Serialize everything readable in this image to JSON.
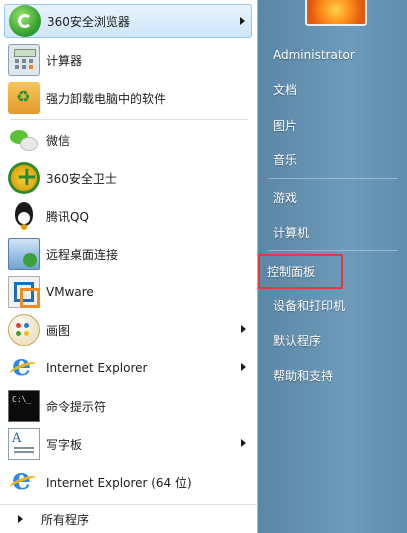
{
  "start_menu": {
    "programs": [
      {
        "label": "360安全浏览器",
        "icon": "browser-360-icon",
        "has_submenu": true
      },
      {
        "label": "计算器",
        "icon": "calculator-icon",
        "has_submenu": false
      },
      {
        "label": "强力卸载电脑中的软件",
        "icon": "uninstall-icon",
        "has_submenu": false
      },
      {
        "label": "微信",
        "icon": "wechat-icon",
        "has_submenu": false
      },
      {
        "label": "360安全卫士",
        "icon": "security-guard-360-icon",
        "has_submenu": false
      },
      {
        "label": "腾讯QQ",
        "icon": "qq-icon",
        "has_submenu": false
      },
      {
        "label": "远程桌面连接",
        "icon": "remote-desktop-icon",
        "has_submenu": false
      },
      {
        "label": "VMware",
        "icon": "vmware-icon",
        "has_submenu": false
      },
      {
        "label": "画图",
        "icon": "paint-icon",
        "has_submenu": true
      },
      {
        "label": "Internet Explorer",
        "icon": "internet-explorer-icon",
        "has_submenu": true
      },
      {
        "label": "命令提示符",
        "icon": "command-prompt-icon",
        "has_submenu": false
      },
      {
        "label": "写字板",
        "icon": "wordpad-icon",
        "has_submenu": true
      },
      {
        "label": "Internet Explorer (64 位)",
        "icon": "internet-explorer-icon",
        "has_submenu": false
      }
    ],
    "all_programs_label": "所有程序",
    "right_pane": {
      "user_name": "Administrator",
      "items": [
        "文档",
        "图片",
        "音乐",
        "游戏",
        "计算机",
        "控制面板",
        "设备和打印机",
        "默认程序",
        "帮助和支持"
      ],
      "selected_item": "控制面板",
      "selection_color": "#e23b3b"
    }
  }
}
